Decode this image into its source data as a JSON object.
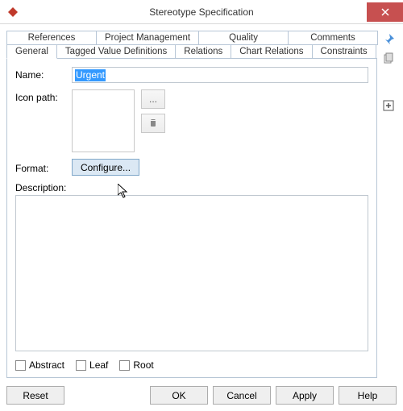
{
  "title": "Stereotype Specification",
  "tabs_row1": [
    "References",
    "Project Management",
    "Quality",
    "Comments"
  ],
  "tabs_row2": [
    "General",
    "Tagged Value Definitions",
    "Relations",
    "Chart Relations",
    "Constraints"
  ],
  "active_tab": "General",
  "general": {
    "name_label": "Name:",
    "name_value": "Urgent",
    "iconpath_label": "Icon path:",
    "browse_label": "...",
    "format_label": "Format:",
    "configure_label": "Configure...",
    "description_label": "Description:",
    "abstract_label": "Abstract",
    "leaf_label": "Leaf",
    "root_label": "Root"
  },
  "buttons": {
    "reset": "Reset",
    "ok": "OK",
    "cancel": "Cancel",
    "apply": "Apply",
    "help": "Help"
  },
  "side": {
    "pin": "pin-icon",
    "copy": "copy-icon",
    "add": "add-icon"
  }
}
